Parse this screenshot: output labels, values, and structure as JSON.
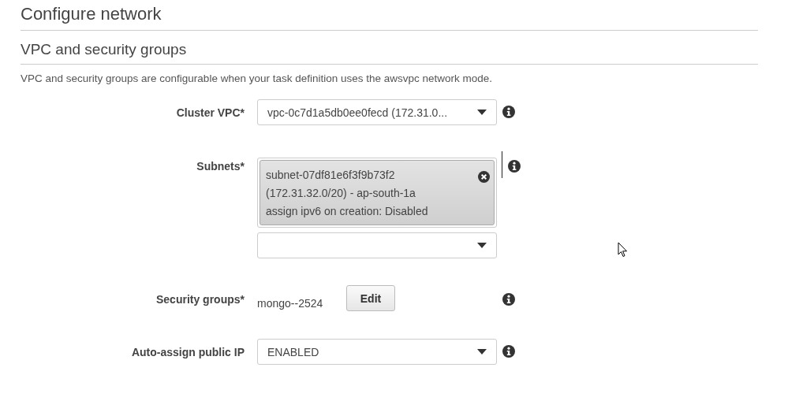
{
  "title": "Configure network",
  "section": {
    "title": "VPC and security groups",
    "description": "VPC and security groups are configurable when your task definition uses the awsvpc network mode."
  },
  "fields": [
    {
      "kind": "select",
      "label": "Cluster VPC*",
      "value": "vpc-0c7d1a5db0ee0fecd (172.31.0..."
    },
    {
      "kind": "multiselect",
      "label": "Subnets*",
      "tags": [
        {
          "lines": [
            "subnet-07df81e6f3f9b73f2",
            "(172.31.32.0/20) - ap-south-1a",
            "assign ipv6 on creation: Disabled"
          ]
        }
      ]
    },
    {
      "kind": "edit",
      "label": "Security groups*",
      "value": "mongo--2524",
      "button": "Edit"
    },
    {
      "kind": "select",
      "label": "Auto-assign public IP",
      "value": "ENABLED"
    }
  ]
}
